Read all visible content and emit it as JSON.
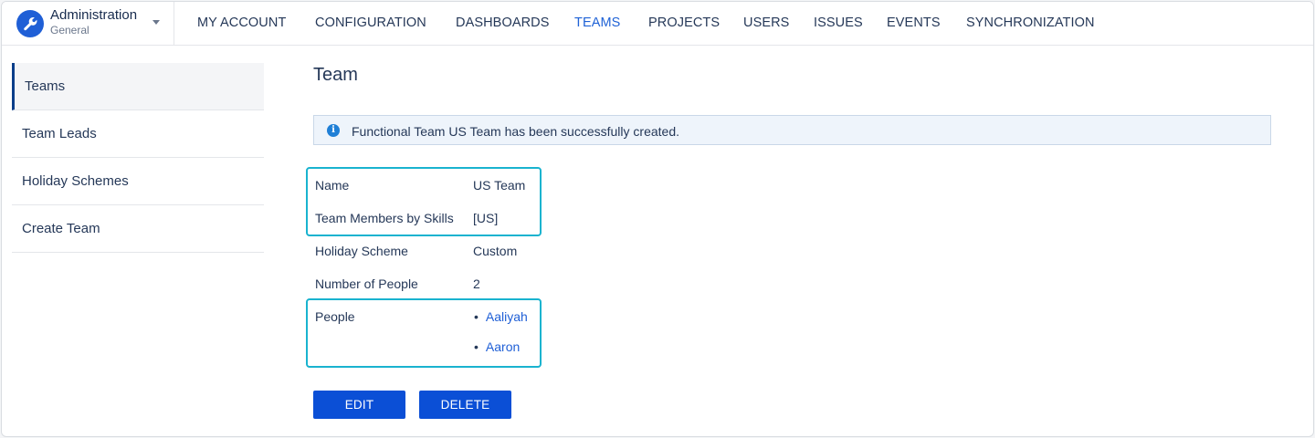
{
  "app": {
    "title": "Administration",
    "subtitle": "General",
    "icon": "wrench-icon"
  },
  "nav": {
    "items": [
      {
        "label": "MY ACCOUNT"
      },
      {
        "label": "CONFIGURATION"
      },
      {
        "label": "DASHBOARDS"
      },
      {
        "label": "TEAMS",
        "active": true
      },
      {
        "label": "PROJECTS"
      },
      {
        "label": "USERS"
      },
      {
        "label": "ISSUES"
      },
      {
        "label": "EVENTS"
      },
      {
        "label": "SYNCHRONIZATION"
      }
    ]
  },
  "sidebar": {
    "items": [
      {
        "label": "Teams",
        "active": true
      },
      {
        "label": "Team Leads"
      },
      {
        "label": "Holiday Schemes"
      },
      {
        "label": "Create Team"
      }
    ]
  },
  "main": {
    "title": "Team",
    "banner": {
      "icon": "info-icon",
      "icon_glyph": "i",
      "text": "Functional Team US Team has been successfully created."
    },
    "details": {
      "name_label": "Name",
      "name_value": "US Team",
      "skills_label": "Team Members by Skills",
      "skills_value": "[US]",
      "holiday_label": "Holiday Scheme",
      "holiday_value": "Custom",
      "count_label": "Number of People",
      "count_value": "2",
      "people_label": "People",
      "people": [
        "Aaliyah",
        "Aaron"
      ]
    },
    "buttons": {
      "edit": "EDIT",
      "delete": "DELETE"
    }
  },
  "colors": {
    "accent": "#1f62d6",
    "button": "#0b4fd6",
    "highlight": "#19b3cf",
    "banner_bg": "#eef4fb"
  }
}
